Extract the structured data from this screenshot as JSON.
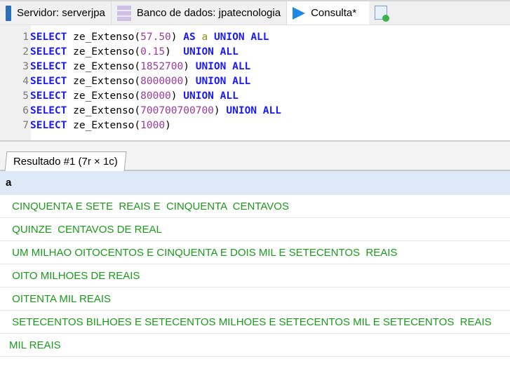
{
  "tabs": [
    {
      "label": "Servidor: serverjpa",
      "icon": "server-icon"
    },
    {
      "label": "Banco de dados: jpatecnologia",
      "icon": "database-icon"
    },
    {
      "label": "Consulta*",
      "icon": "play-icon",
      "active": true
    }
  ],
  "new_query_icon": "new-query-icon",
  "editor": {
    "lines": [
      {
        "n": "1",
        "fn": "ze_Extenso(",
        "arg": "57.50",
        ")": ") ",
        "as": "AS ",
        "alias": "a ",
        "union": "UNION ALL"
      },
      {
        "n": "2",
        "fn": "ze_Extenso(",
        "arg": "0.15",
        ")": ")  ",
        "as": "",
        "alias": "",
        "union": "UNION ALL"
      },
      {
        "n": "3",
        "fn": "ze_Extenso(",
        "arg": "1852700",
        ")": ") ",
        "as": "",
        "alias": "",
        "union": "UNION ALL"
      },
      {
        "n": "4",
        "fn": "ze_Extenso(",
        "arg": "8000000",
        ")": ") ",
        "as": "",
        "alias": "",
        "union": "UNION ALL"
      },
      {
        "n": "5",
        "fn": "ze_Extenso(",
        "arg": "80000",
        ")": ") ",
        "as": "",
        "alias": "",
        "union": "UNION ALL"
      },
      {
        "n": "6",
        "fn": "ze_Extenso(",
        "arg": "700700700700",
        ")": ") ",
        "as": "",
        "alias": "",
        "union": "UNION ALL"
      },
      {
        "n": "7",
        "fn": "ze_Extenso(",
        "arg": "1000",
        ")": ")",
        "as": "",
        "alias": "",
        "union": ""
      }
    ],
    "select_kw": "SELECT "
  },
  "result": {
    "tab_label": "Resultado #1 (7r × 1c)",
    "column": "a",
    "rows": [
      " CINQUENTA E SETE  REAIS E  CINQUENTA  CENTAVOS",
      " QUINZE  CENTAVOS DE REAL",
      " UM MILHAO OITOCENTOS E CINQUENTA E DOIS MIL E SETECENTOS  REAIS",
      " OITO MILHOES DE REAIS",
      " OITENTA MIL REAIS",
      " SETECENTOS BILHOES E SETECENTOS MILHOES E SETECENTOS MIL E SETECENTOS  REAIS",
      "MIL REAIS"
    ]
  }
}
